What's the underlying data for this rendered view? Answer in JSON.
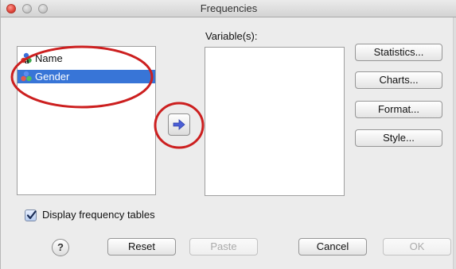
{
  "window": {
    "title": "Frequencies"
  },
  "source_list": {
    "items": [
      {
        "label": "Name",
        "icon": "nominal-string-variable-icon",
        "selected": false
      },
      {
        "label": "Gender",
        "icon": "nominal-variable-icon",
        "selected": true
      }
    ]
  },
  "target_list": {
    "label": "Variable(s):"
  },
  "side_buttons": {
    "statistics": "Statistics...",
    "charts": "Charts...",
    "format": "Format...",
    "style": "Style..."
  },
  "options": {
    "display_frequency_tables_label": "Display frequency tables",
    "display_frequency_tables_checked": true
  },
  "footer": {
    "help": "?",
    "reset": "Reset",
    "paste": "Paste",
    "cancel": "Cancel",
    "ok": "OK"
  },
  "colors": {
    "selection": "#3875d7",
    "annotation_circle": "#cc1f1f",
    "transfer_arrow": "#4b5fd6"
  },
  "icons": {
    "transfer": "arrow-right-icon",
    "checkbox": "checkmark-icon"
  }
}
